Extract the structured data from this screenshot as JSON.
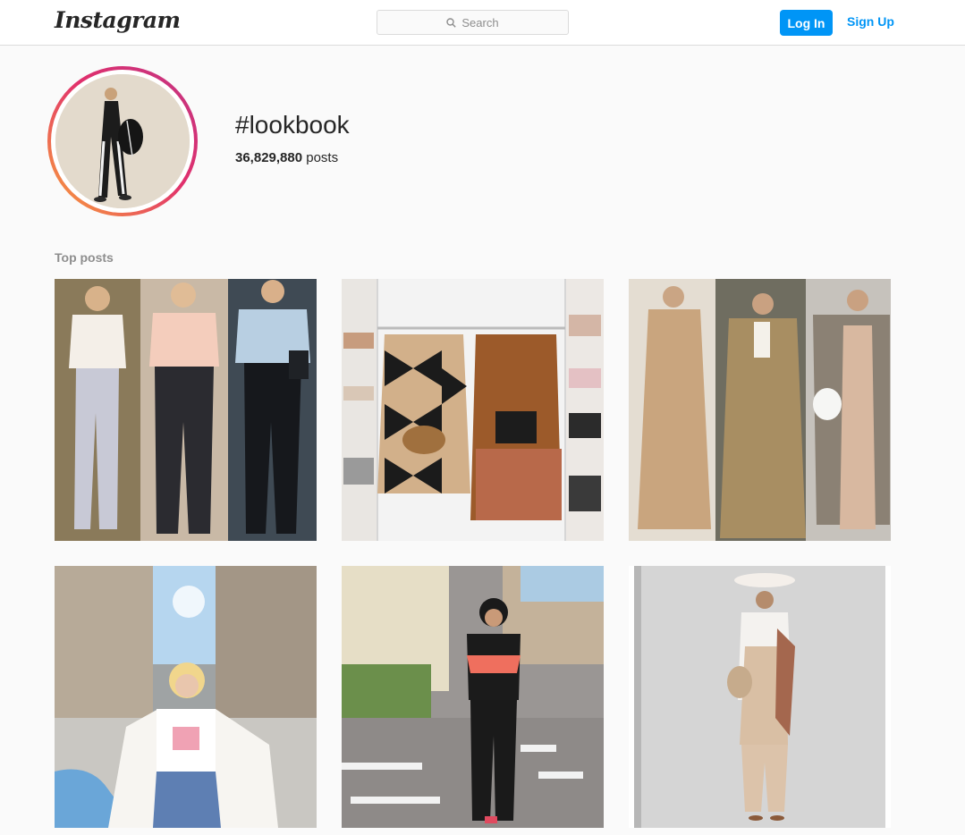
{
  "header": {
    "logo_text": "Instagram",
    "search": {
      "placeholder": "Search",
      "icon": "search-icon"
    },
    "login_label": "Log In",
    "signup_label": "Sign Up"
  },
  "hashtag": {
    "title": "#lookbook",
    "post_count": "36,829,880",
    "post_count_suffix": "posts"
  },
  "top_posts": {
    "heading": "Top posts",
    "items": [
      {
        "subject": "three-women-blouses-trousers"
      },
      {
        "subject": "coats-on-hangers-in-closet"
      },
      {
        "subject": "three-women-camel-coats"
      },
      {
        "subject": "woman-white-cardigan-street"
      },
      {
        "subject": "woman-black-outfit-crosswalk"
      },
      {
        "subject": "woman-hat-beige-jumpsuit"
      }
    ]
  },
  "colors": {
    "accent_blue": "#0095f6",
    "text": "#262626",
    "muted_text": "#8e8e8e",
    "border": "#dbdbdb",
    "background": "#fafafa",
    "ring_gradient_start": "#f9a43a",
    "ring_gradient_end": "#c13584"
  }
}
